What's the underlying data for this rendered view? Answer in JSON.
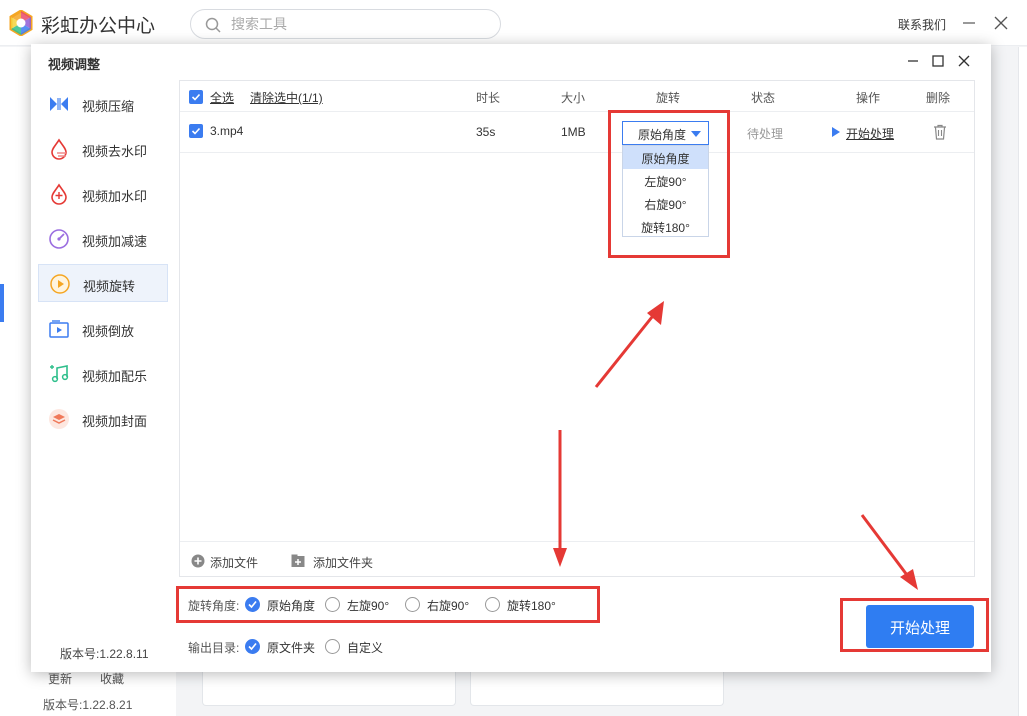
{
  "app": {
    "title": "彩虹办公中心",
    "search_placeholder": "搜索工具",
    "contact_label": "联系我们",
    "bottom_links": [
      "更新",
      "收藏"
    ],
    "version": "版本号:1.22.8.21"
  },
  "dialog": {
    "title": "视频调整",
    "version": "版本号:1.22.8.11",
    "sidebar": [
      {
        "label": "视频压缩",
        "icon": "video-compress-icon"
      },
      {
        "label": "视频去水印",
        "icon": "remove-watermark-icon"
      },
      {
        "label": "视频加水印",
        "icon": "add-watermark-icon"
      },
      {
        "label": "视频加减速",
        "icon": "speed-gauge-icon"
      },
      {
        "label": "视频旋转",
        "icon": "rotate-icon",
        "active": true
      },
      {
        "label": "视频倒放",
        "icon": "reverse-play-icon"
      },
      {
        "label": "视频加配乐",
        "icon": "music-note-icon"
      },
      {
        "label": "视频加封面",
        "icon": "cover-layers-icon"
      }
    ],
    "table": {
      "select_all": "全选",
      "clear_selected": "清除选中(1/1)",
      "columns": [
        "时长",
        "大小",
        "旋转",
        "状态",
        "操作",
        "删除"
      ],
      "rows": [
        {
          "name": "3.mp4",
          "duration": "35s",
          "size": "1MB",
          "rotation": "原始角度",
          "status": "待处理",
          "action": "开始处理"
        }
      ]
    },
    "rotation_options": [
      "原始角度",
      "左旋90°",
      "右旋90°",
      "旋转180°"
    ],
    "footer": {
      "add_file": "添加文件",
      "add_folder": "添加文件夹"
    },
    "rotate_angle": {
      "label": "旋转角度:",
      "options": [
        "原始角度",
        "左旋90°",
        "右旋90°",
        "旋转180°"
      ],
      "selected": 0
    },
    "output_dir": {
      "label": "输出目录:",
      "options": [
        "原文件夹",
        "自定义"
      ],
      "selected": 0
    },
    "start_button": "开始处理"
  },
  "colors": {
    "accent": "#2f7df2",
    "annotation": "#e53935"
  }
}
